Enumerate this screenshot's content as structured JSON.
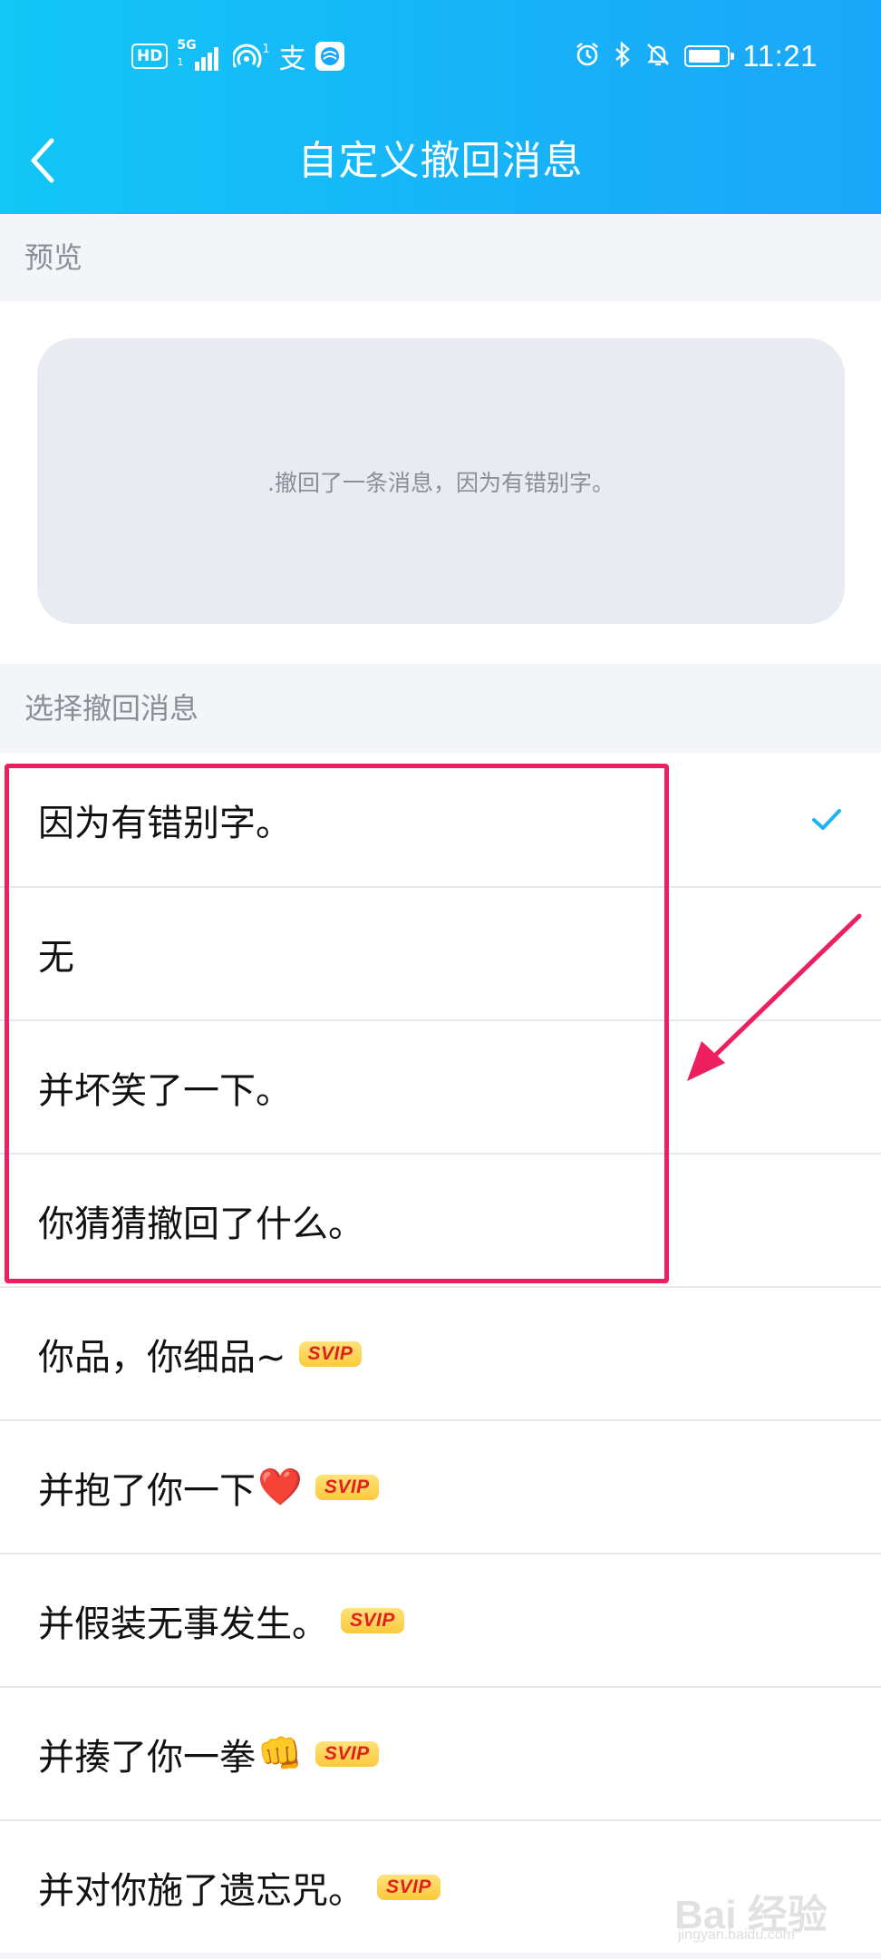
{
  "status_bar": {
    "hd": "HD",
    "network": "5G",
    "network_sub": "1",
    "hotspot_sub": "1",
    "alipay_glyph": "支",
    "time": "11:21",
    "battery_level": 0.85
  },
  "header": {
    "title": "自定义撤回消息",
    "back_icon": "chevron-left-icon"
  },
  "preview": {
    "section_label": "预览",
    "message": ".撤回了一条消息，因为有错别字。"
  },
  "choices": {
    "section_label": "选择撤回消息",
    "items": [
      {
        "label": "因为有错别字。",
        "selected": true,
        "svip": ""
      },
      {
        "label": "无",
        "selected": false,
        "svip": ""
      },
      {
        "label": "并坏笑了一下。",
        "selected": false,
        "svip": ""
      },
      {
        "label": "你猜猜撤回了什么。",
        "selected": false,
        "svip": ""
      },
      {
        "label": "你品，你细品~",
        "selected": false,
        "svip": "SVIP"
      },
      {
        "label": "并抱了你一下",
        "emoji": "❤️",
        "selected": false,
        "svip": "SVIP"
      },
      {
        "label": "并假装无事发生。",
        "selected": false,
        "svip": "SVIP"
      },
      {
        "label": "并揍了你一拳",
        "emoji": "👊",
        "selected": false,
        "svip": "SVIP"
      },
      {
        "label": "并对你施了遗忘咒。",
        "selected": false,
        "svip": "SVIP"
      }
    ]
  },
  "annotation": {
    "highlight_color": "#ee1f5e"
  },
  "watermark": {
    "main": "Bai 经验",
    "sub": "jingyan.baidu.com"
  },
  "colors": {
    "header_gradient_start": "#12c6f6",
    "header_gradient_end": "#1aa6f8",
    "check": "#1fb3f2",
    "svip_text": "#e02020",
    "svip_bg": "#fcc93c"
  }
}
